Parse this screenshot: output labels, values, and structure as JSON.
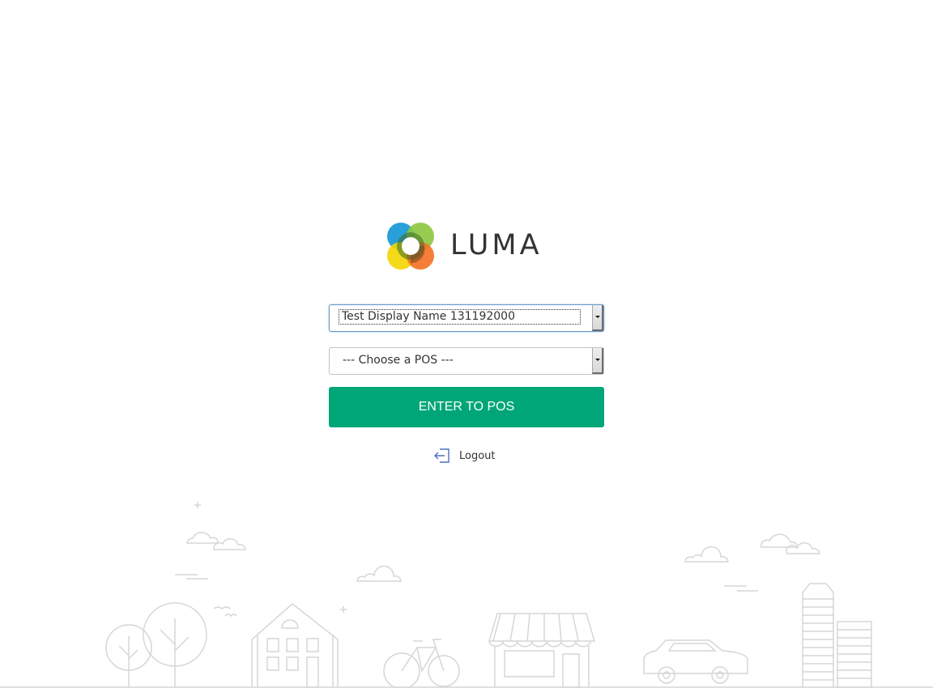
{
  "brand": {
    "name": "LUMA",
    "colors": {
      "blue": "#1e9bd7",
      "green": "#8cc63f",
      "yellow": "#f2d500",
      "orange": "#f37021",
      "dark_green": "#2e6b2a",
      "brown": "#7a4a1e"
    }
  },
  "form": {
    "location_select": {
      "selected": "Test Display Name 131192000",
      "focused": true
    },
    "pos_select": {
      "selected": "--- Choose a POS ---"
    },
    "enter_button": {
      "label": "ENTER TO POS",
      "color": "#00a678"
    }
  },
  "logout": {
    "label": "Logout",
    "icon": "logout-icon",
    "icon_color": "#4a6fc1"
  },
  "background": {
    "scenery_color": "#d6d6d6"
  }
}
